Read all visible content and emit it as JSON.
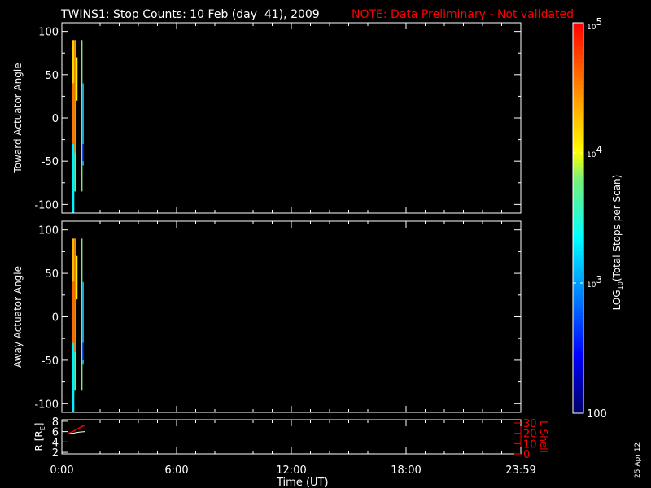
{
  "chart_data": {
    "type": "heatmap",
    "title": "TWINS1: Stop Counts: 10 Feb (day  41), 2009",
    "note": "NOTE: Data Preliminary - Not validated",
    "xlabel": "Time (UT)",
    "xlim_hours": [
      0,
      24
    ],
    "x_ticks": [
      "0:00",
      "6:00",
      "12:00",
      "18:00",
      "23:59"
    ],
    "panels": [
      {
        "ylabel": "Toward Actuator Angle",
        "ylim": [
          -110,
          110
        ],
        "y_ticks": [
          "100",
          "50",
          "0",
          "-50",
          "-100"
        ],
        "segments": [
          {
            "t0": 0.55,
            "t1": 0.65,
            "a0": 40,
            "a1": 90,
            "log": 4.2
          },
          {
            "t0": 0.55,
            "t1": 0.65,
            "a0": -30,
            "a1": 40,
            "log": 4.55
          },
          {
            "t0": 0.55,
            "t1": 0.65,
            "a0": -110,
            "a1": -30,
            "log": 3.3
          },
          {
            "t0": 0.65,
            "t1": 0.75,
            "a0": -40,
            "a1": 90,
            "log": 4.45
          },
          {
            "t0": 0.65,
            "t1": 0.75,
            "a0": -85,
            "a1": -40,
            "log": 3.6
          },
          {
            "t0": 0.75,
            "t1": 0.82,
            "a0": 20,
            "a1": 70,
            "log": 4.1
          },
          {
            "t0": 1.0,
            "t1": 1.08,
            "a0": -85,
            "a1": 90,
            "log": 3.8
          },
          {
            "t0": 1.08,
            "t1": 1.15,
            "a0": -55,
            "a1": 40,
            "log": 3.0
          },
          {
            "t0": 1.08,
            "t1": 1.15,
            "a0": -50,
            "a1": -30,
            "log": 2.5
          }
        ]
      },
      {
        "ylabel": "Away Actuator Angle",
        "ylim": [
          -110,
          110
        ],
        "y_ticks": [
          "100",
          "50",
          "0",
          "-50",
          "-100"
        ],
        "segments": [
          {
            "t0": 0.55,
            "t1": 0.65,
            "a0": 40,
            "a1": 90,
            "log": 4.3
          },
          {
            "t0": 0.55,
            "t1": 0.65,
            "a0": -30,
            "a1": 40,
            "log": 4.6
          },
          {
            "t0": 0.55,
            "t1": 0.65,
            "a0": -110,
            "a1": -30,
            "log": 3.3
          },
          {
            "t0": 0.65,
            "t1": 0.75,
            "a0": -40,
            "a1": 90,
            "log": 4.5
          },
          {
            "t0": 0.65,
            "t1": 0.75,
            "a0": -85,
            "a1": -40,
            "log": 3.6
          },
          {
            "t0": 0.75,
            "t1": 0.82,
            "a0": 20,
            "a1": 70,
            "log": 4.1
          },
          {
            "t0": 1.0,
            "t1": 1.08,
            "a0": -85,
            "a1": 90,
            "log": 3.8
          },
          {
            "t0": 1.08,
            "t1": 1.15,
            "a0": -55,
            "a1": 40,
            "log": 3.0
          },
          {
            "t0": 1.08,
            "t1": 1.15,
            "a0": -50,
            "a1": -30,
            "log": 2.5
          }
        ]
      }
    ],
    "ephemeris": {
      "left_label": "R [R",
      "left_label_sub": "E",
      "left_label_end": "]",
      "left_ylim": [
        1.7,
        8.3
      ],
      "left_ticks": [
        "8",
        "6",
        "4",
        "2"
      ],
      "right_label": "L Shell",
      "right_ylim": [
        0,
        30
      ],
      "right_ticks": [
        "30",
        "20",
        "10",
        "0"
      ],
      "r_series": {
        "t": [
          0.3,
          0.6,
          0.9,
          1.2
        ],
        "v": [
          5.6,
          5.7,
          5.9,
          6.0
        ]
      },
      "l_series": {
        "t": [
          0.35,
          0.6,
          0.9,
          1.2
        ],
        "v": [
          20,
          22,
          25,
          28
        ]
      }
    },
    "colorbar": {
      "label": "LOG",
      "label_sub": "10",
      "label_rest": "(Total Stops per Scan)",
      "range_log": [
        2,
        5
      ],
      "tick_100": "100",
      "tick_base": "10",
      "tick_exps": [
        "3",
        "4",
        "5"
      ]
    },
    "colors": {
      "axis": "#ffffff",
      "note": "#ff0000",
      "lshell": "#ff0000"
    }
  },
  "footer_date": "25 Apr 12"
}
